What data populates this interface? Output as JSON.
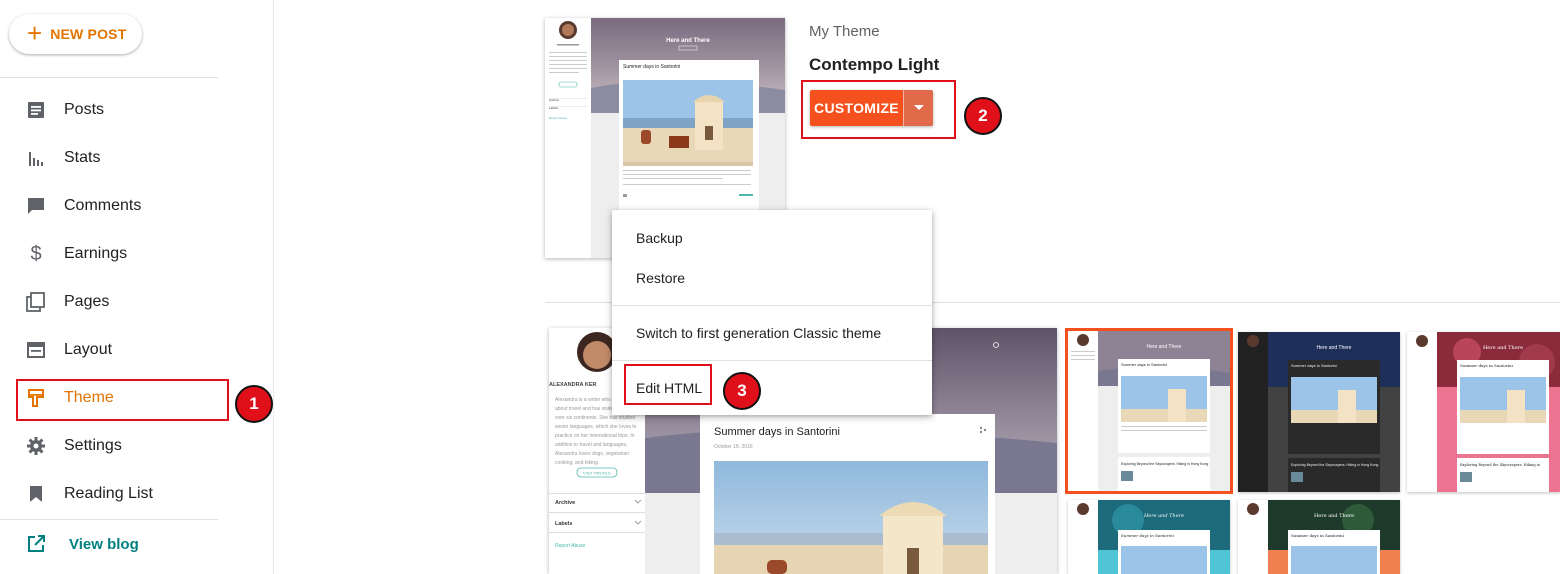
{
  "sidebar": {
    "new_post": "NEW POST",
    "items": [
      {
        "label": "Posts",
        "icon": "posts-icon"
      },
      {
        "label": "Stats",
        "icon": "stats-icon"
      },
      {
        "label": "Comments",
        "icon": "comments-icon"
      },
      {
        "label": "Earnings",
        "icon": "dollar-icon"
      },
      {
        "label": "Pages",
        "icon": "pages-icon"
      },
      {
        "label": "Layout",
        "icon": "layout-icon"
      },
      {
        "label": "Theme",
        "icon": "theme-icon",
        "active": true
      },
      {
        "label": "Settings",
        "icon": "gear-icon"
      },
      {
        "label": "Reading List",
        "icon": "bookmark-icon"
      }
    ],
    "view_blog": "View blog"
  },
  "theme": {
    "heading": "My Theme",
    "name": "Contempo Light",
    "customize": "CUSTOMIZE"
  },
  "menu": {
    "backup": "Backup",
    "restore": "Restore",
    "classic": "Switch to first generation Classic theme",
    "edit_html": "Edit HTML"
  },
  "annotations": {
    "step1": "1",
    "step2": "2",
    "step3": "3"
  },
  "preview": {
    "blog_title": "Here and There",
    "post_title": "Summer days in Santorini",
    "post_date": "October 18, 2016",
    "author": "ALEXANDRA KER",
    "bio": "Alexandra is a writer who writes about travel and has visited over six continents. She has studied seven languages, which she loves to practice on her international trips. In addition to travel and languages, Alexandra loves dogs, vegetarian cooking, and hiking.",
    "visit_profile": "VISIT PROFILE",
    "archive": "Archive",
    "labels": "Labels",
    "report_abuse": "Report Abuse",
    "second_post": "Exploring Beyond the Skyscrapers: Hiking in Hong Kong"
  },
  "colors": {
    "accent": "#e37400",
    "customize": "#f4511e",
    "annotation": "#e0101a",
    "link": "#008080"
  }
}
